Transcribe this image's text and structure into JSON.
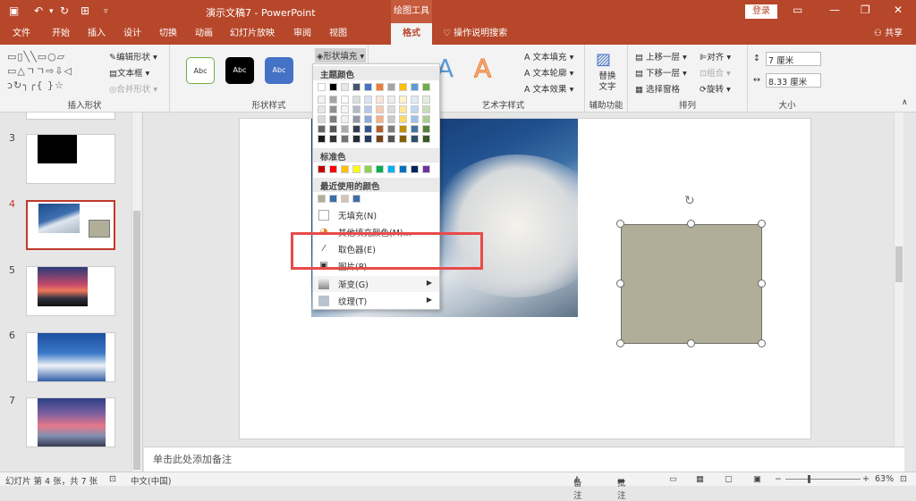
{
  "window": {
    "title": "演示文稿7  -  PowerPoint",
    "context_tab": "绘图工具",
    "login": "登录"
  },
  "tabs": [
    "文件",
    "开始",
    "插入",
    "设计",
    "切换",
    "动画",
    "幻灯片放映",
    "审阅",
    "视图",
    "格式"
  ],
  "tell_me": "操作说明搜索",
  "share": "共享",
  "ribbon": {
    "insert_shapes": {
      "label": "插入形状",
      "edit_shape": "编辑形状",
      "text_box": "文本框",
      "merge_shapes": "合并形状"
    },
    "shape_styles": {
      "label": "形状样式",
      "abc1": "Abc",
      "abc2": "Abc",
      "abc3": "Abc",
      "fill": "形状填充"
    },
    "wordart": {
      "label": "艺术字样式",
      "text_fill": "文本填充",
      "text_outline": "文本轮廓",
      "text_effect": "文本效果"
    },
    "accessibility": {
      "label": "辅助功能",
      "alt_text": "替换文字"
    },
    "arrange": {
      "label": "排列",
      "bring_forward": "上移一层",
      "send_backward": "下移一层",
      "selection_pane": "选择窗格",
      "align": "对齐",
      "group": "组合",
      "rotate": "旋转"
    },
    "size": {
      "label": "大小",
      "height": "7 厘米",
      "width": "8.33 厘米"
    }
  },
  "fill_menu": {
    "theme_colors_header": "主题颜色",
    "standard_colors_header": "标准色",
    "recent_colors_header": "最近使用的颜色",
    "no_fill": "无填充(N)",
    "more_colors": "其他填充颜色(M)...",
    "eyedropper": "取色器(E)",
    "picture": "图片(P)...",
    "gradient": "渐变(G)",
    "texture": "纹理(T)",
    "theme_top_row": [
      "#ffffff",
      "#000000",
      "#e7e6e6",
      "#44546a",
      "#4472c4",
      "#ed7d31",
      "#a5a5a5",
      "#ffc000",
      "#5b9bd5",
      "#70ad47"
    ],
    "standard": [
      "#c00000",
      "#ff0000",
      "#ffc000",
      "#ffff00",
      "#92d050",
      "#00b050",
      "#00b0f0",
      "#0070c0",
      "#002060",
      "#7030a0"
    ],
    "recent": [
      "#b0ae98",
      "#3a6ea5",
      "#d4c4b8",
      "#3a6ea5"
    ]
  },
  "slides": {
    "numbers": [
      "3",
      "4",
      "5",
      "6",
      "7"
    ],
    "active": "4"
  },
  "notes_placeholder": "单击此处添加备注",
  "status": {
    "slide_info": "幻灯片 第 4 张，共 7 张",
    "language": "中文(中国)",
    "notes": "备注",
    "comments": "批注",
    "zoom": "63%"
  },
  "shape_fill_color": "#b0ae98"
}
